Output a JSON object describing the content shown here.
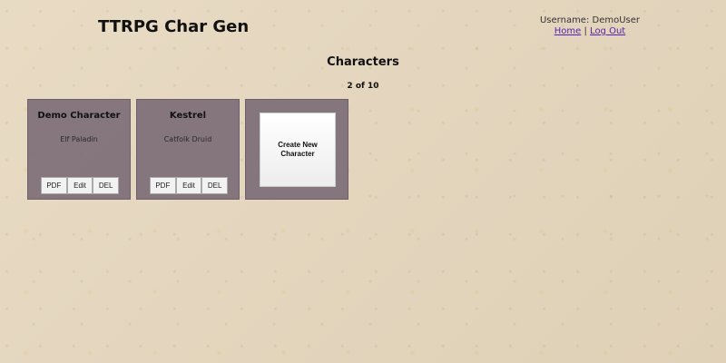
{
  "header": {
    "app_title": "TTRPG Char Gen",
    "username_text": "Username: DemoUser",
    "home_link": "Home",
    "separator": "|",
    "logout_link": "Log Out"
  },
  "main": {
    "section_title": "Characters",
    "count_text": "2 of 10",
    "characters": [
      {
        "name": "Demo Character",
        "description": "Elf Paladin",
        "actions": {
          "pdf": "PDF",
          "edit": "Edit",
          "delete": "DEL"
        }
      },
      {
        "name": "Kestrel",
        "description": "Catfolk Druid",
        "actions": {
          "pdf": "PDF",
          "edit": "Edit",
          "delete": "DEL"
        }
      }
    ],
    "create_card": {
      "label": "Create New Character"
    }
  },
  "theme": {
    "background": "#e6d7bd",
    "card_bg": "#7a6c76",
    "link_color": "#5a1fb0"
  }
}
